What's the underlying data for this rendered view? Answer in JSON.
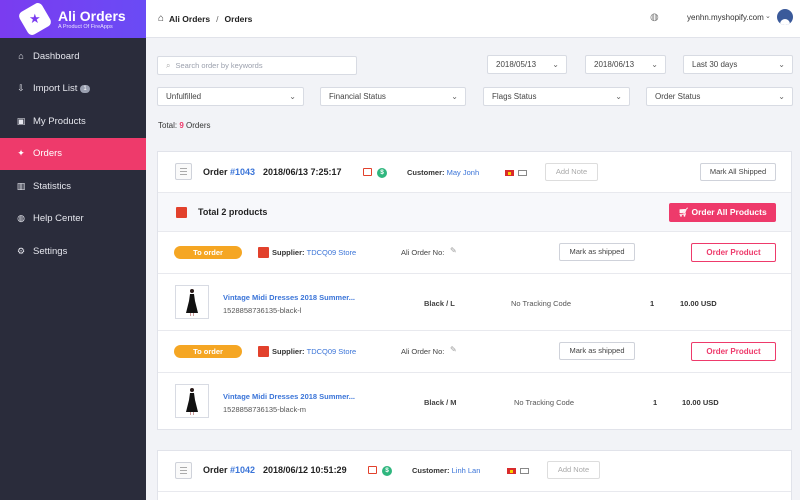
{
  "brand": {
    "title": "Ali Orders",
    "subtitle": "A Product Of FireApps"
  },
  "sidebar": {
    "items": [
      {
        "label": "Dashboard",
        "icon": "home-icon",
        "glyph": "⌂",
        "active": false
      },
      {
        "label": "Import List",
        "icon": "import-icon",
        "glyph": "⇩",
        "badge": "1",
        "active": false
      },
      {
        "label": "My Products",
        "icon": "box-icon",
        "glyph": "▣",
        "active": false
      },
      {
        "label": "Orders",
        "icon": "gift-icon",
        "glyph": "✦",
        "active": true
      },
      {
        "label": "Statistics",
        "icon": "bar-chart-icon",
        "glyph": "▥",
        "active": false
      },
      {
        "label": "Help Center",
        "icon": "globe-icon",
        "glyph": "◍",
        "active": false
      },
      {
        "label": "Settings",
        "icon": "gear-icon",
        "glyph": "⚙",
        "active": false
      }
    ]
  },
  "header": {
    "breadcrumb": [
      "Ali Orders",
      "Orders"
    ],
    "account": "yenhn.myshopify.com"
  },
  "filters": {
    "search_placeholder": "Search order by keywords",
    "date_from": "2018/05/13",
    "date_to": "2018/06/13",
    "range": "Last 30 days",
    "fulfillment": "Unfulfilled",
    "financial": "Financial Status",
    "flags": "Flags Status",
    "order_status": "Order Status"
  },
  "total": {
    "prefix": "Total:",
    "count": "9",
    "suffix": "Orders"
  },
  "orders": [
    {
      "label": "Order",
      "number": "#1043",
      "date": "2018/06/13 7:25:17",
      "customer_label": "Customer:",
      "customer": "May Jonh",
      "add_note": "Add Note",
      "mark_all": "Mark All Shipped",
      "total_products": "Total 2 products",
      "order_all": "Order All Products",
      "lines": [
        {
          "status": "To order",
          "supplier_label": "Supplier:",
          "supplier": "TDCQ09 Store",
          "ali_label": "Ali Order No:",
          "mark_shipped": "Mark as shipped",
          "order_product": "Order Product",
          "title": "Vintage Midi Dresses 2018 Summer...",
          "sku": "1528858736135-black-l",
          "variant": "Black / L",
          "tracking": "No Tracking Code",
          "qty": "1",
          "price": "10.00 USD"
        },
        {
          "status": "To order",
          "supplier_label": "Supplier:",
          "supplier": "TDCQ09 Store",
          "ali_label": "Ali Order No:",
          "mark_shipped": "Mark as shipped",
          "order_product": "Order Product",
          "title": "Vintage Midi Dresses 2018 Summer...",
          "sku": "1528858736135-black-m",
          "variant": "Black / M",
          "tracking": "No Tracking Code",
          "qty": "1",
          "price": "10.00 USD"
        }
      ]
    },
    {
      "label": "Order",
      "number": "#1042",
      "date": "2018/06/12 10:51:29",
      "customer_label": "Customer:",
      "customer": "Linh Lan",
      "add_note": "Add Note"
    }
  ],
  "colors": {
    "accent": "#ee3a6b",
    "brand": "#7a3cf0",
    "sidebar": "#2a2c3b",
    "link": "#3a74d8",
    "status_to_order": "#f5a623"
  }
}
